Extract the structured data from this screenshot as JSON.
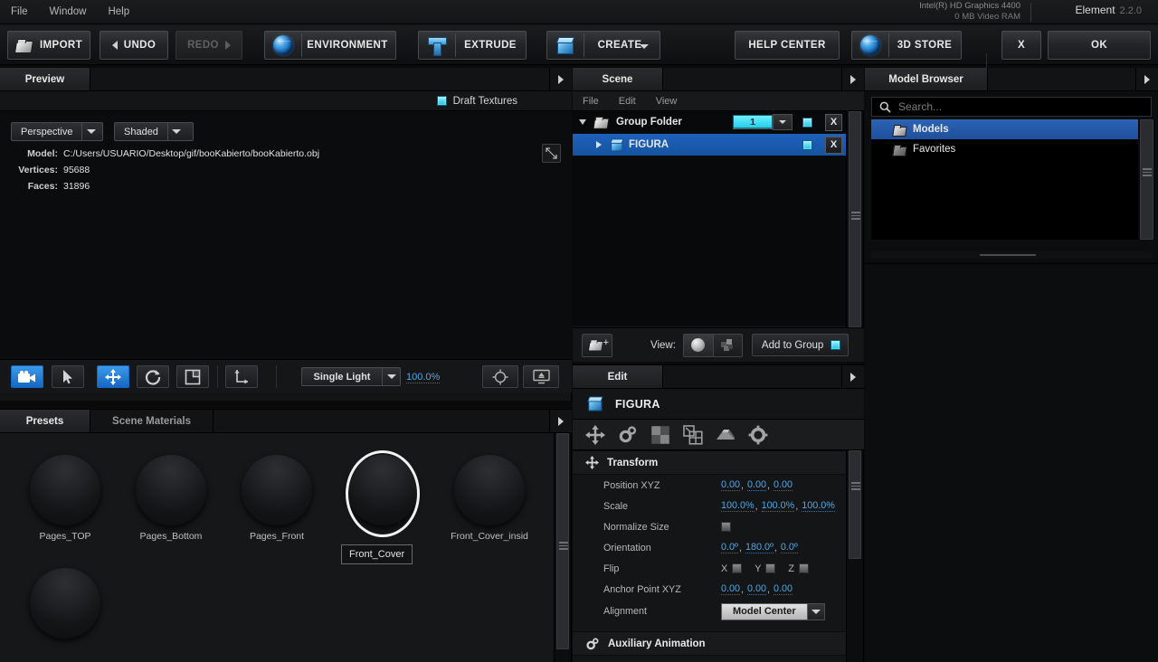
{
  "app": {
    "brand": "Element",
    "version": "2.2.0",
    "gpu": "Intel(R) HD Graphics 4400",
    "vram": "0 MB Video RAM"
  },
  "menubar": {
    "items": [
      {
        "label": "File"
      },
      {
        "label": "Window"
      },
      {
        "label": "Help"
      }
    ]
  },
  "toolbar": {
    "import": "IMPORT",
    "undo": "UNDO",
    "redo": "REDO",
    "environment": "ENVIRONMENT",
    "extrude": "EXTRUDE",
    "create": "CREATE",
    "help_center": "HELP CENTER",
    "store": "3D STORE",
    "close": "X",
    "ok": "OK"
  },
  "preview": {
    "tab": "Preview",
    "draft_textures": "Draft Textures",
    "camera_mode": "Perspective",
    "shading_mode": "Shaded",
    "info": {
      "model_key": "Model:",
      "model_value": "C:/Users/USUARIO/Desktop/gif/booKabierto/booKabierto.obj",
      "vertices_key": "Vertices:",
      "vertices_value": "95688",
      "faces_key": "Faces:",
      "faces_value": "31896"
    },
    "light_mode": "Single Light",
    "light_value": "100.0%"
  },
  "materials": {
    "tabs": [
      {
        "label": "Presets",
        "active": true
      },
      {
        "label": "Scene Materials",
        "active": false
      }
    ],
    "tooltip": "Front_Cover",
    "items": [
      {
        "name": "Pages_TOP",
        "selected": false
      },
      {
        "name": "Pages_Bottom",
        "selected": false
      },
      {
        "name": "Pages_Front",
        "selected": false
      },
      {
        "name": "Front_Cover",
        "selected": true
      },
      {
        "name": "Front_Cover_insid",
        "selected": false
      },
      {
        "name": "",
        "selected": false
      }
    ]
  },
  "scene": {
    "tab": "Scene",
    "menu": [
      {
        "label": "File"
      },
      {
        "label": "Edit"
      },
      {
        "label": "View"
      }
    ],
    "tree": [
      {
        "label": "Group Folder",
        "icon": "folder-icon",
        "expanded": true,
        "selected": false,
        "group_number": "1",
        "visible": true,
        "delete": "X",
        "indent": 0
      },
      {
        "label": "FIGURA",
        "icon": "cube-icon",
        "expanded": false,
        "selected": true,
        "group_number": "",
        "visible": true,
        "delete": "X",
        "indent": 1
      }
    ],
    "footer": {
      "view_label": "View:",
      "add_to_group": "Add to Group"
    }
  },
  "edit": {
    "tab": "Edit",
    "object_name": "FIGURA",
    "icons": [
      "transform-icon",
      "auxiliary-animation-icon",
      "materials-icon",
      "replicator-icon",
      "extrude-shape-icon",
      "settings-gear-icon"
    ],
    "sections": [
      {
        "title": "Transform",
        "icon": "move-icon",
        "rows": [
          {
            "key": "Position XYZ",
            "type": "xyz",
            "values": [
              "0.00",
              "0.00",
              "0.00"
            ]
          },
          {
            "key": "Scale",
            "type": "xyz",
            "values": [
              "100.0%",
              "100.0%",
              "100.0%"
            ]
          },
          {
            "key": "Normalize Size",
            "type": "checkbox",
            "checked": false
          },
          {
            "key": "Orientation",
            "type": "xyz",
            "values": [
              "0.0º",
              "180.0º",
              "0.0º"
            ]
          },
          {
            "key": "Flip",
            "type": "flip",
            "axes": [
              "X",
              "Y",
              "Z"
            ]
          },
          {
            "key": "Anchor Point XYZ",
            "type": "xyz",
            "values": [
              "0.00",
              "0.00",
              "0.00"
            ]
          },
          {
            "key": "Alignment",
            "type": "combo",
            "value": "Model Center"
          }
        ]
      },
      {
        "title": "Auxiliary Animation",
        "icon": "gears-icon",
        "rows": []
      }
    ]
  },
  "browser": {
    "tab": "Model Browser",
    "search_placeholder": "Search...",
    "search_value": "",
    "items": [
      {
        "label": "Models",
        "selected": true
      },
      {
        "label": "Favorites",
        "selected": false
      }
    ]
  },
  "colors": {
    "accent_blue": "#1e62bd",
    "cyan": "#24cdeb",
    "link_blue": "#4ea8e8",
    "panel_bg": "#141517"
  }
}
